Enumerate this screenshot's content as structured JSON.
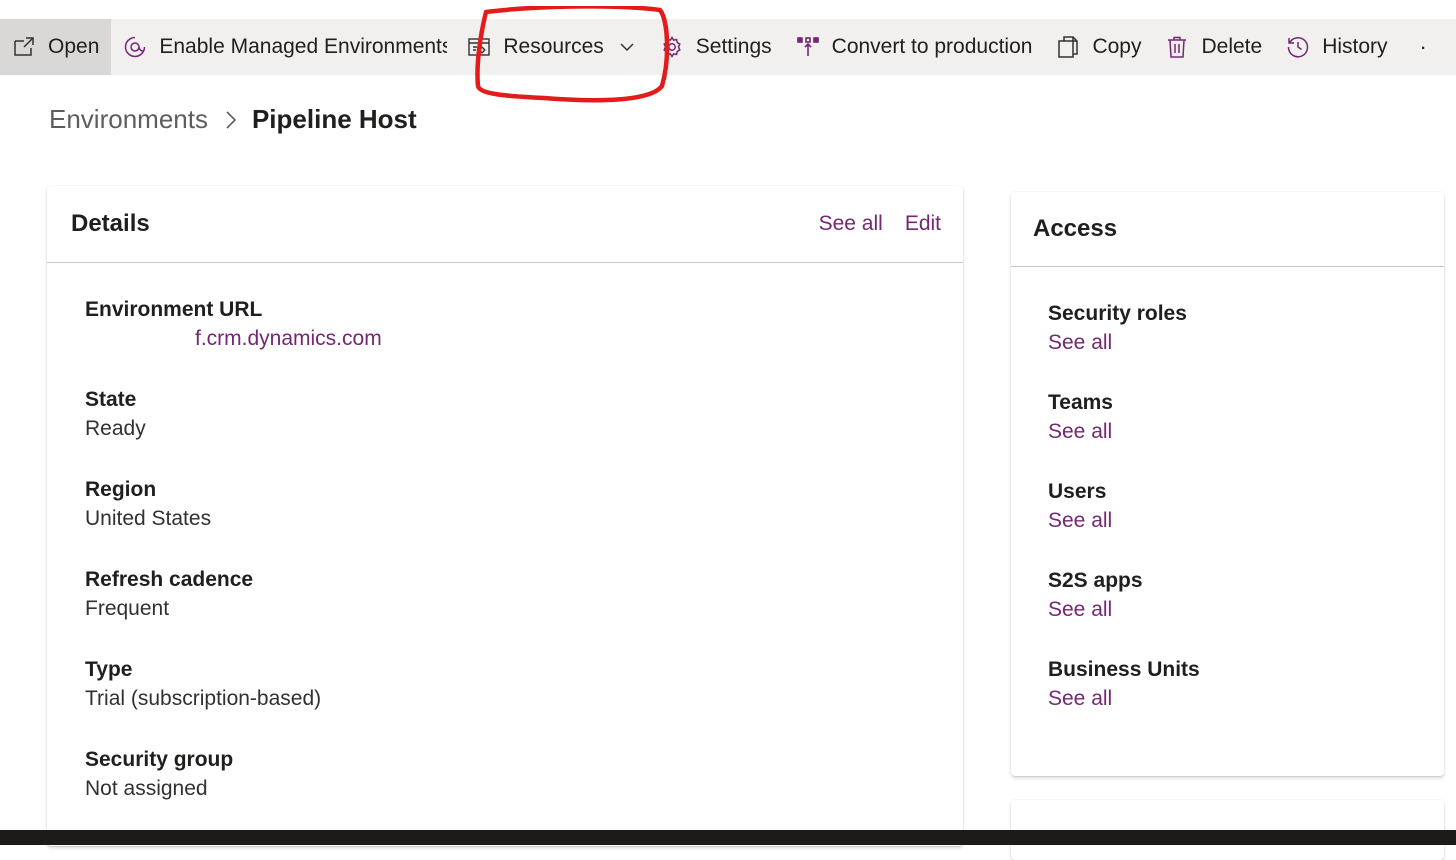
{
  "toolbar": {
    "items": [
      {
        "label": "Open",
        "icon": "open-external-icon"
      },
      {
        "label": "Enable Managed Environments",
        "icon": "managed-environment-icon"
      },
      {
        "label": "Resources",
        "icon": "resources-icon"
      },
      {
        "label": "Settings",
        "icon": "gear-icon"
      },
      {
        "label": "Convert to production",
        "icon": "convert-icon"
      },
      {
        "label": "Copy",
        "icon": "copy-icon"
      },
      {
        "label": "Delete",
        "icon": "trash-icon"
      },
      {
        "label": "History",
        "icon": "history-icon"
      }
    ],
    "more": "·"
  },
  "annotation": {
    "color": "#e31b1b"
  },
  "breadcrumb": {
    "parent": "Environments",
    "current": "Pipeline Host"
  },
  "details": {
    "title": "Details",
    "see_all": "See all",
    "edit": "Edit",
    "fields": [
      {
        "label": "Environment URL",
        "value": "f.crm.dynamics.com"
      },
      {
        "label": "State",
        "value": "Ready"
      },
      {
        "label": "Region",
        "value": "United States"
      },
      {
        "label": "Refresh cadence",
        "value": "Frequent"
      },
      {
        "label": "Type",
        "value": "Trial (subscription-based)"
      },
      {
        "label": "Security group",
        "value": "Not assigned"
      }
    ]
  },
  "access": {
    "title": "Access",
    "items": [
      {
        "label": "Security roles",
        "link": "See all"
      },
      {
        "label": "Teams",
        "link": "See all"
      },
      {
        "label": "Users",
        "link": "See all"
      },
      {
        "label": "S2S apps",
        "link": "See all"
      },
      {
        "label": "Business Units",
        "link": "See all"
      }
    ]
  },
  "colors": {
    "accent": "#742774",
    "toolbar_bg": "#f1f0ef"
  }
}
